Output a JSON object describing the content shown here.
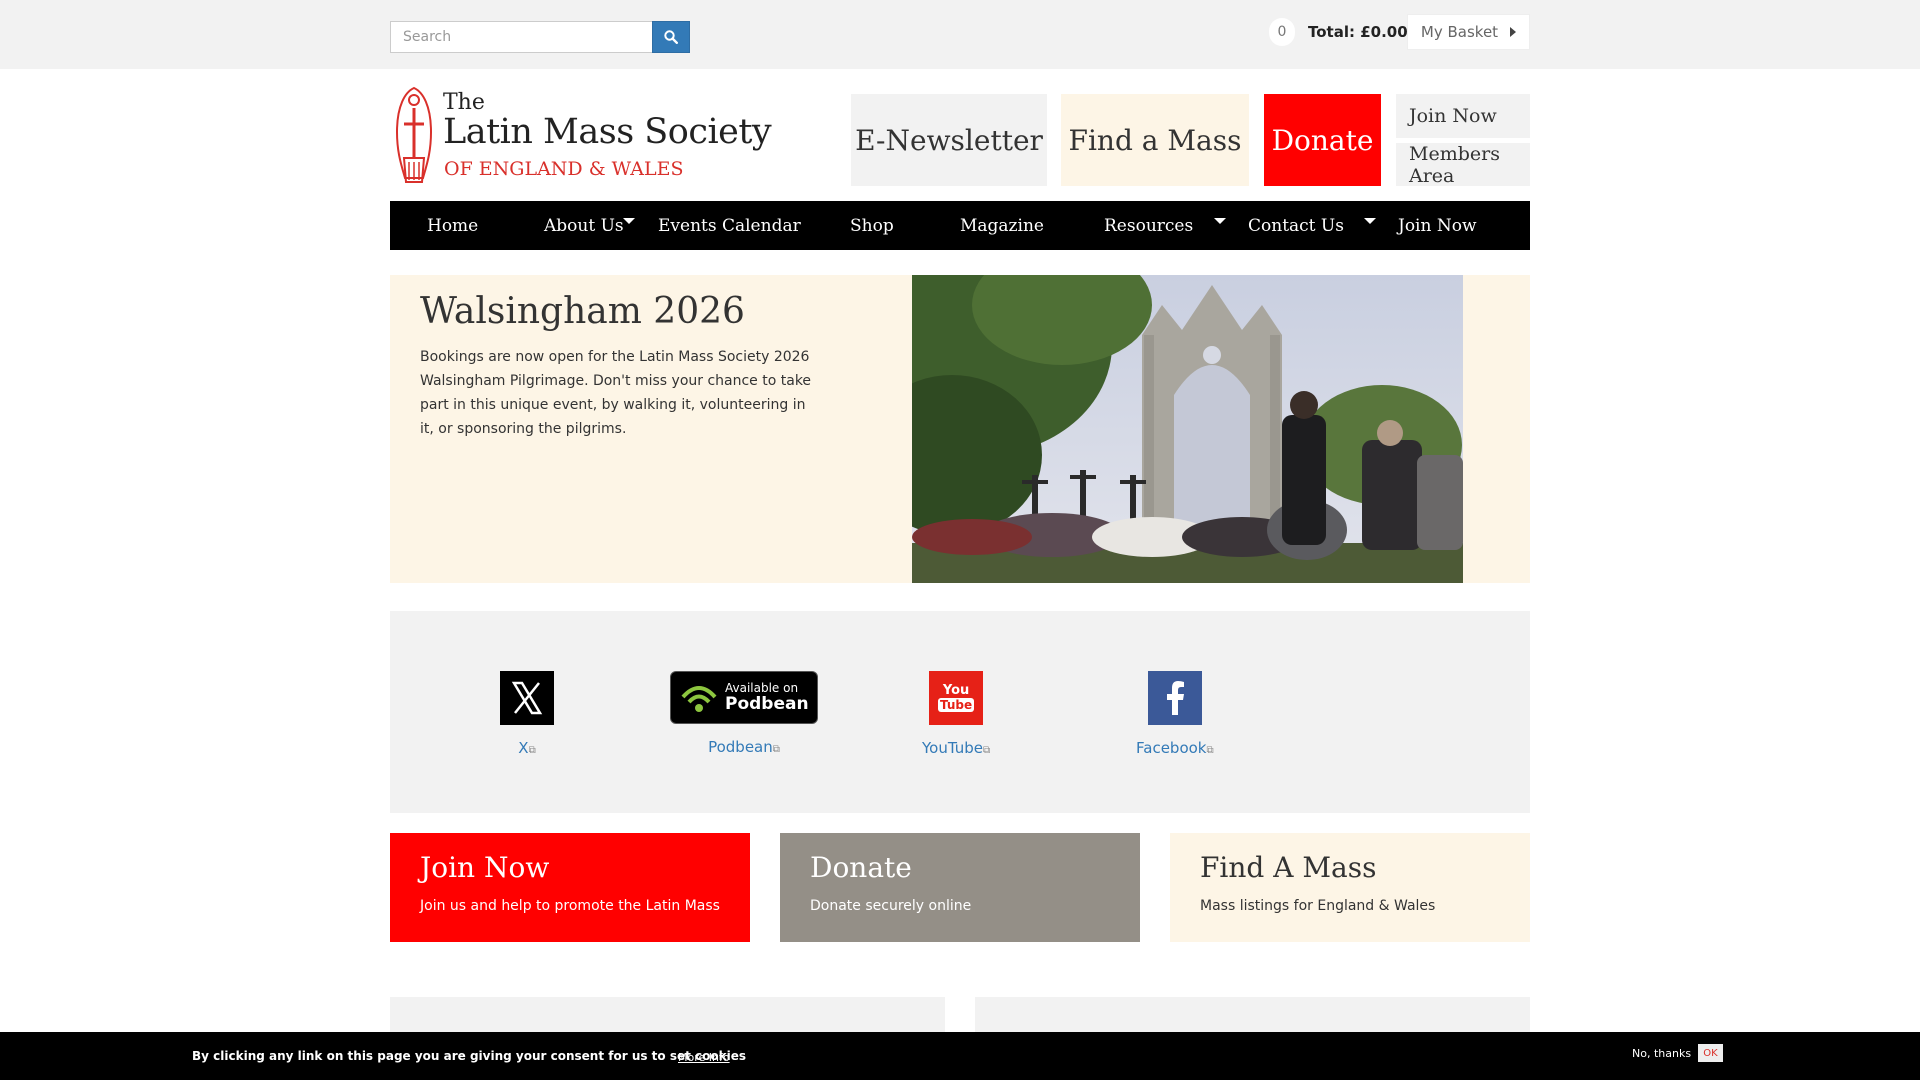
{
  "topbar": {
    "search_placeholder": "Search",
    "basket_count": "0",
    "basket_total": "Total: £0.00",
    "basket_button": "My Basket"
  },
  "logo": {
    "line1": "The",
    "line2": "Latin Mass Society",
    "line3": "OF ENGLAND & WALES"
  },
  "header_buttons": {
    "newsletter": "E-Newsletter",
    "find_mass": "Find a Mass",
    "donate": "Donate",
    "join": "Join Now",
    "members": "Members Area"
  },
  "nav": {
    "items": [
      {
        "label": "Home"
      },
      {
        "label": "About Us"
      },
      {
        "label": "Events Calendar"
      },
      {
        "label": "Shop"
      },
      {
        "label": "Magazine"
      },
      {
        "label": "Resources"
      },
      {
        "label": "Contact Us"
      },
      {
        "label": "Join Now"
      }
    ]
  },
  "hero": {
    "title": "Walsingham 2026",
    "text": "Bookings are now open for the Latin Mass Society 2026 Walsingham Pilgrimage. Don't miss your chance to take part in this unique event, by walking it, volunteering in it, or sponsoring the pilgrims."
  },
  "social": {
    "x": "X",
    "podbean": "Podbean",
    "podbean_badge_top": "Available on",
    "podbean_badge_bottom": "Podbean",
    "youtube": "YouTube",
    "youtube_badge_top": "You",
    "youtube_badge_bottom": "Tube",
    "facebook": "Facebook"
  },
  "tiles": {
    "join": {
      "title": "Join Now",
      "subtitle": "Join us and help to promote the Latin Mass"
    },
    "donate": {
      "title": "Donate",
      "subtitle": "Donate securely online"
    },
    "find": {
      "title": "Find A Mass",
      "subtitle": "Mass listings for England & Wales"
    }
  },
  "cookie": {
    "text": "By clicking any link on this page you are giving your consent for us to set cookies",
    "more": "More Info",
    "no": "No, thanks",
    "ok": "OK"
  },
  "colors": {
    "brand_red": "#ff0000",
    "cream": "#fdf5e6",
    "link_blue": "#337ab7",
    "nav_black": "#000000"
  }
}
